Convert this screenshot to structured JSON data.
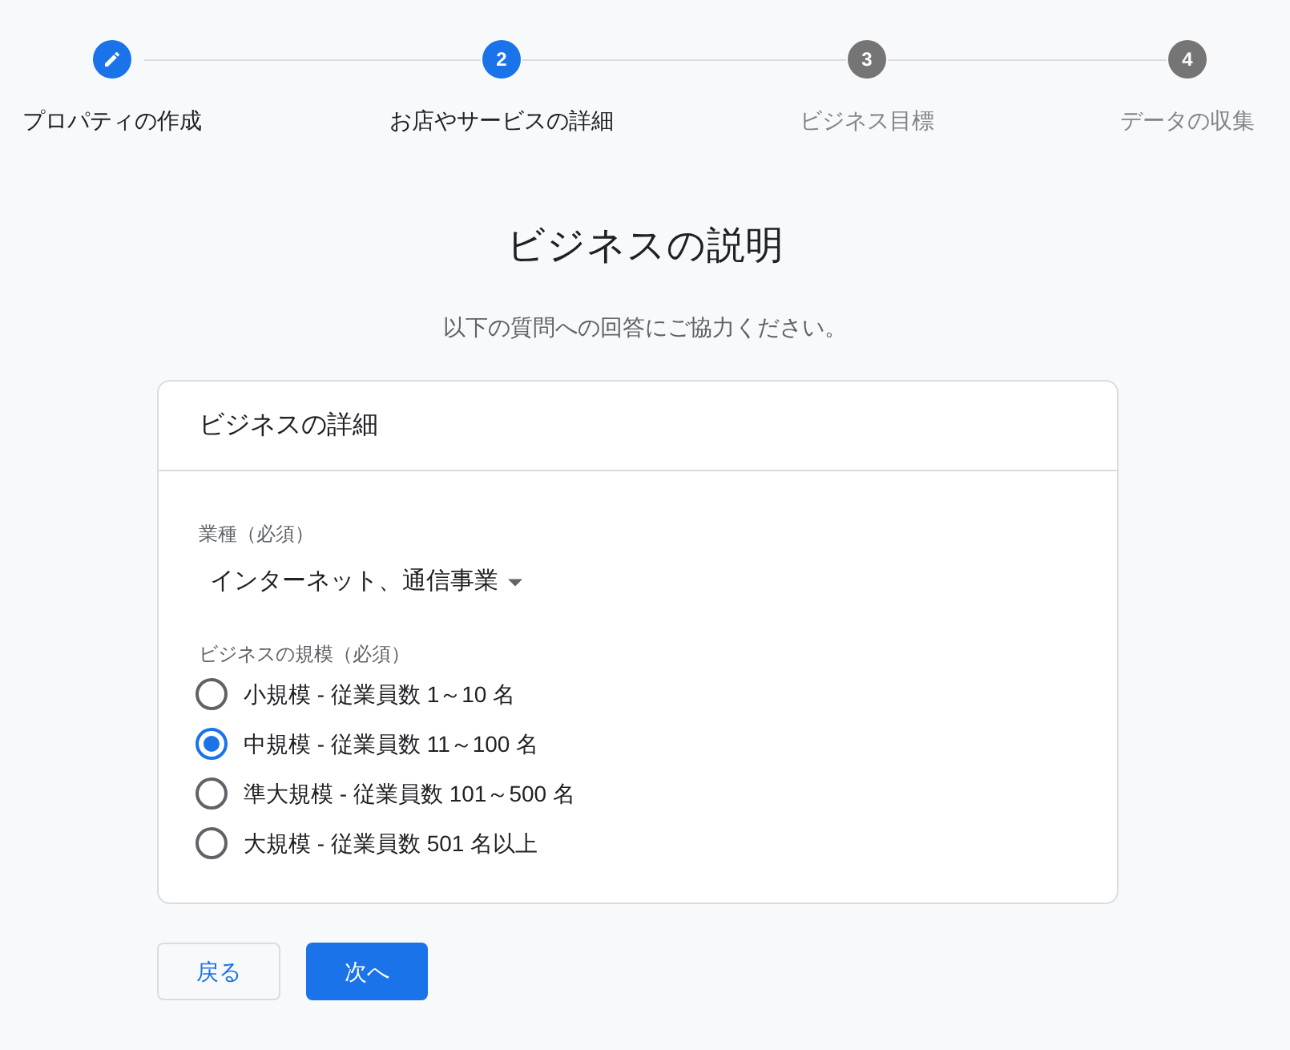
{
  "steps": [
    {
      "label": "プロパティの作成",
      "kind": "edit",
      "reached": true
    },
    {
      "label": "お店やサービスの詳細",
      "kind": "number",
      "reached": true,
      "number": "2"
    },
    {
      "label": "ビジネス目標",
      "kind": "number",
      "reached": false,
      "number": "3"
    },
    {
      "label": "データの収集",
      "kind": "number",
      "reached": false,
      "number": "4"
    }
  ],
  "title": "ビジネスの説明",
  "subtitle": "以下の質問への回答にご協力ください。",
  "card": {
    "title": "ビジネスの詳細",
    "industry": {
      "label": "業種（必須）",
      "value": "インターネット、通信事業"
    },
    "size": {
      "label": "ビジネスの規模（必須）",
      "options": [
        {
          "label": "小規模 - 従業員数 1～10 名",
          "selected": false
        },
        {
          "label": "中規模 - 従業員数 11～100 名",
          "selected": true
        },
        {
          "label": "準大規模 - 従業員数 101～500 名",
          "selected": false
        },
        {
          "label": "大規模 - 従業員数 501 名以上",
          "selected": false
        }
      ]
    }
  },
  "buttons": {
    "back": "戻る",
    "next": "次へ"
  }
}
